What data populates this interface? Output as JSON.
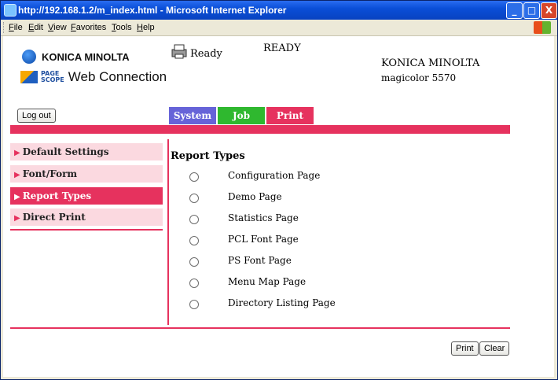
{
  "window": {
    "title": "http://192.168.1.2/m_index.html - Microsoft Internet Explorer",
    "minimize": "_",
    "maximize": "□",
    "close": "X"
  },
  "menu": [
    "File",
    "Edit",
    "View",
    "Favorites",
    "Tools",
    "Help"
  ],
  "header": {
    "brand": "KONICA MINOLTA",
    "pagescope_line1": "PAGE",
    "pagescope_line2": "SCOPE",
    "web_connection": "Web Connection",
    "status_icon_text": "Ready",
    "status_text": "READY",
    "model_line1": "KONICA MINOLTA",
    "model_line2": "magicolor 5570"
  },
  "buttons": {
    "logout": "Log out",
    "print": "Print",
    "clear": "Clear"
  },
  "tabs": [
    {
      "label": "System",
      "color": "#6663d8"
    },
    {
      "label": "Job",
      "color": "#2fb82f"
    },
    {
      "label": "Print",
      "color": "#e6325e"
    }
  ],
  "sidebar": {
    "items": [
      {
        "label": "Default Settings"
      },
      {
        "label": "Font/Form"
      },
      {
        "label": "Report Types"
      },
      {
        "label": "Direct Print"
      }
    ],
    "active": "Report Types"
  },
  "main": {
    "section_title": "Report Types",
    "options": [
      "Configuration Page",
      "Demo Page",
      "Statistics Page",
      "PCL Font Page",
      "PS Font Page",
      "Menu Map Page",
      "Directory Listing Page"
    ]
  },
  "colors": {
    "accent": "#e6325e",
    "nav_bg": "#fbd9e0",
    "system_tab": "#6663d8",
    "job_tab": "#2fb82f"
  },
  "icons": {
    "printer": "printer-icon",
    "brand": "konica-minolta-globe-icon",
    "pagescope": "pagescope-logo-icon",
    "windows": "windows-logo-icon"
  }
}
